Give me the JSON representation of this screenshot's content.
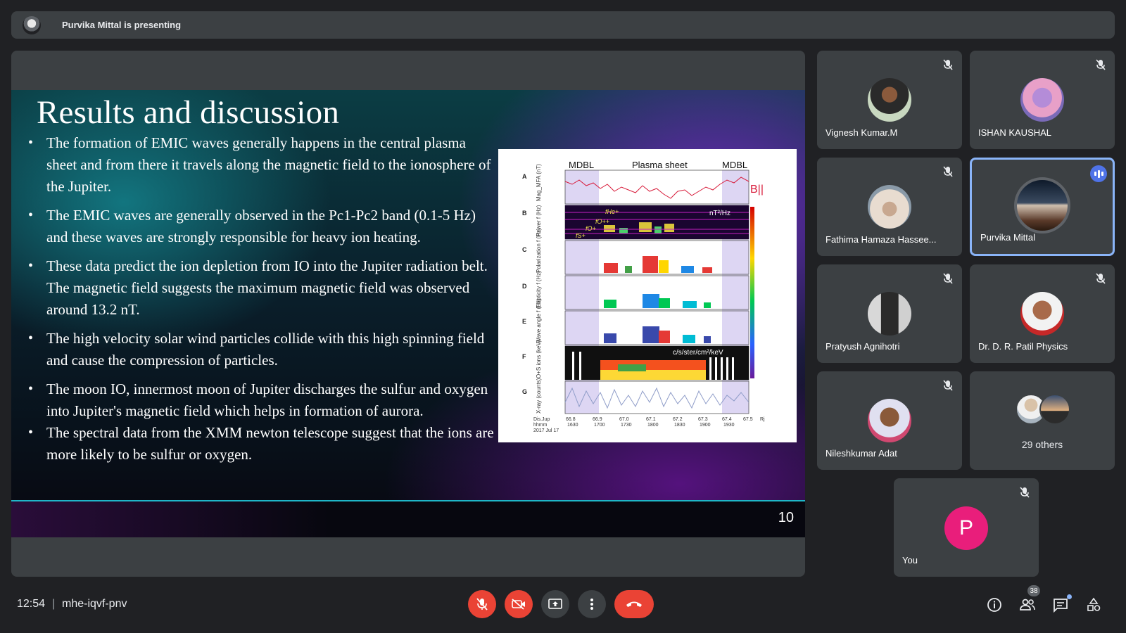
{
  "presenter_bar": {
    "text": "Purvika Mittal is presenting"
  },
  "slide": {
    "title": "Results and discussion",
    "bullets": [
      "The formation of EMIC waves generally happens in the central plasma sheet and from there it travels along the magnetic field to the ionosphere of the Jupiter.",
      "The EMIC waves are generally observed in the Pc1-Pc2 band (0.1-5 Hz) and these waves are strongly responsible for heavy ion heating.",
      "These data predict the ion depletion from IO into the Jupiter radiation belt. The magnetic field suggests the maximum magnetic field was observed around 13.2 nT.",
      "The high velocity solar wind particles collide with this high spinning field and cause the compression of particles.",
      "The moon IO, innermost moon of Jupiter discharges the sulfur and oxygen into Jupiter's magnetic field which helps in formation of aurora.",
      "The spectral data from the XMM newton telescope suggest that the ions are more likely to be sulfur or oxygen."
    ],
    "page_number": "10",
    "figure": {
      "header_left": "MDBL",
      "header_center": "Plasma sheet",
      "header_right": "MDBL",
      "field_label": "B||",
      "power_unit": "nT²/Hz",
      "flux_unit": "c/s/ster/cm²/keV",
      "panel_letters": [
        "A",
        "B",
        "C",
        "D",
        "E",
        "F",
        "G"
      ],
      "panel_labels": [
        "Mag_MFA (nT)",
        "Power f (Hz)",
        "Polarization f (Hz)",
        "Ellipticity f (Hz)",
        "Wave angle f (Hz)",
        "O+S ions (keV)",
        "X-ray (counts)"
      ],
      "ion_labels": [
        "fHe+",
        "fO++",
        "fO+",
        "fS+"
      ],
      "x_ticks": [
        "66.8",
        "66.9",
        "67.0",
        "67.1",
        "67.2",
        "67.3",
        "67.4",
        "67.5"
      ],
      "x_ticks_time": [
        "1630",
        "1700",
        "1730",
        "1800",
        "1830",
        "1900",
        "1930"
      ],
      "x_unit": "Rj",
      "x_caption": [
        "Dis.Jup",
        "hhmm",
        "2017 Jul 17"
      ]
    }
  },
  "participants": [
    {
      "name": "Vignesh Kumar.M",
      "muted": true,
      "avatar": "photo-man-dark"
    },
    {
      "name": "ISHAN KAUSHAL",
      "muted": true,
      "avatar": "photo-deity"
    },
    {
      "name": "Fathima Hamaza Hassee...",
      "muted": true,
      "avatar": "photo-angel"
    },
    {
      "name": "Purvika Mittal",
      "muted": false,
      "speaking": true,
      "avatar": "photo-landscape"
    },
    {
      "name": "Pratyush Agnihotri",
      "muted": true,
      "avatar": "photo-man-bw"
    },
    {
      "name": "Dr. D. R. Patil Physics",
      "muted": true,
      "avatar": "photo-man-red"
    },
    {
      "name": "Nileshkumar Adat",
      "muted": true,
      "avatar": "photo-man-pink"
    }
  ],
  "others_tile": {
    "label": "29 others"
  },
  "self_tile": {
    "label": "You",
    "initial": "P",
    "avatar_color": "#e91e7b"
  },
  "bottom_bar": {
    "time": "12:54",
    "meeting_code": "mhe-iqvf-pnv",
    "participant_count": "38"
  },
  "colors": {
    "background": "#202124",
    "tile": "#3c4043",
    "danger": "#ea4335",
    "accent": "#8ab4f8"
  }
}
